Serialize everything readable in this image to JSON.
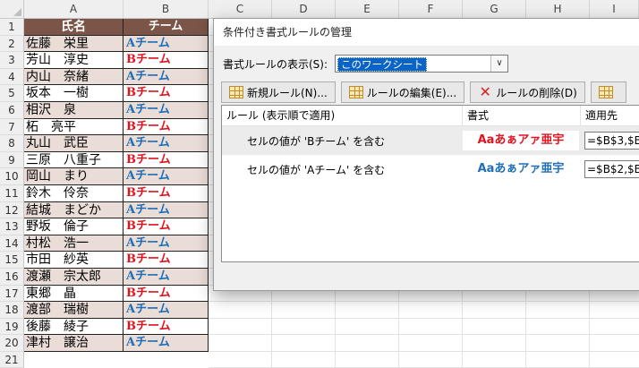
{
  "sheet": {
    "columns": [
      "A",
      "B",
      "C",
      "D",
      "E",
      "F",
      "G",
      "H",
      "I"
    ],
    "header": {
      "name": "氏名",
      "team": "チーム"
    },
    "rows": [
      {
        "num": "1"
      },
      {
        "num": "2",
        "name": "佐藤　栄里",
        "team": "Aチーム"
      },
      {
        "num": "3",
        "name": "芳山　淳史",
        "team": "Bチーム"
      },
      {
        "num": "4",
        "name": "内山　奈緒",
        "team": "Aチーム"
      },
      {
        "num": "5",
        "name": "坂本　一樹",
        "team": "Bチーム"
      },
      {
        "num": "6",
        "name": "相沢　泉",
        "team": "Aチーム"
      },
      {
        "num": "7",
        "name": "柘　亮平",
        "team": "Bチーム"
      },
      {
        "num": "8",
        "name": "丸山　武臣",
        "team": "Aチーム"
      },
      {
        "num": "9",
        "name": "三原　八重子",
        "team": "Bチーム"
      },
      {
        "num": "10",
        "name": "岡山　まり",
        "team": "Aチーム"
      },
      {
        "num": "11",
        "name": "鈴木　伶奈",
        "team": "Bチーム"
      },
      {
        "num": "12",
        "name": "結城　まどか",
        "team": "Aチーム"
      },
      {
        "num": "13",
        "name": "野坂　倫子",
        "team": "Bチーム"
      },
      {
        "num": "14",
        "name": "村松　浩一",
        "team": "Aチーム"
      },
      {
        "num": "15",
        "name": "市田　紗英",
        "team": "Bチーム"
      },
      {
        "num": "16",
        "name": "渡瀬　宗太郎",
        "team": "Aチーム"
      },
      {
        "num": "17",
        "name": "東郷　晶",
        "team": "Bチーム"
      },
      {
        "num": "18",
        "name": "渡部　瑞樹",
        "team": "Aチーム"
      },
      {
        "num": "19",
        "name": "後藤　綾子",
        "team": "Bチーム"
      },
      {
        "num": "20",
        "name": "津村　譲治",
        "team": "Aチーム"
      },
      {
        "num": "21"
      }
    ],
    "colors": {
      "header_bg": "#7a5548",
      "shade_bg": "#eadcd6",
      "teamA": "#1f6fb8",
      "teamB": "#e0141e"
    }
  },
  "dialog": {
    "title": "条件付き書式ルールの管理",
    "show_label": "書式ルールの表示(S):",
    "show_value": "このワークシート",
    "buttons": {
      "new_rule": "新規ルール(N)...",
      "edit_rule": "ルールの編集(E)...",
      "delete_rule": "ルールの削除(D)"
    },
    "list_headers": {
      "rule": "ルール (表示順で適用)",
      "format": "書式",
      "applies": "適用先"
    },
    "rules": [
      {
        "rule": "セルの値が 'Bチーム' を含む",
        "preview": "Aaあぁアァ亜宇",
        "preview_color": "#e0141e",
        "applies": "=$B$3,$B"
      },
      {
        "rule": "セルの値が 'Aチーム' を含む",
        "preview": "Aaあぁアァ亜宇",
        "preview_color": "#1f6fb8",
        "applies": "=$B$2,$B"
      }
    ]
  }
}
